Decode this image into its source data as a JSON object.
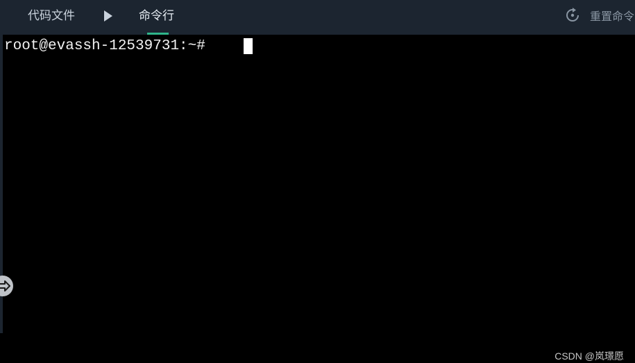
{
  "header": {
    "tabs": [
      {
        "label": "代码文件",
        "active": false
      },
      {
        "label": "命令行",
        "active": true
      }
    ],
    "run_icon": "play-icon",
    "reset": {
      "icon": "refresh-icon",
      "label": "重置命令"
    }
  },
  "terminal": {
    "prompt": "root@evassh-12539731:~# "
  },
  "side_toggle": {
    "icon": "exit-arrow-icon"
  },
  "watermark": "CSDN @岚璟愿",
  "colors": {
    "header_bg": "#1c2530",
    "active_tab_underline": "#2fb58a",
    "terminal_bg": "#000000",
    "terminal_text": "#f2f2f2"
  }
}
